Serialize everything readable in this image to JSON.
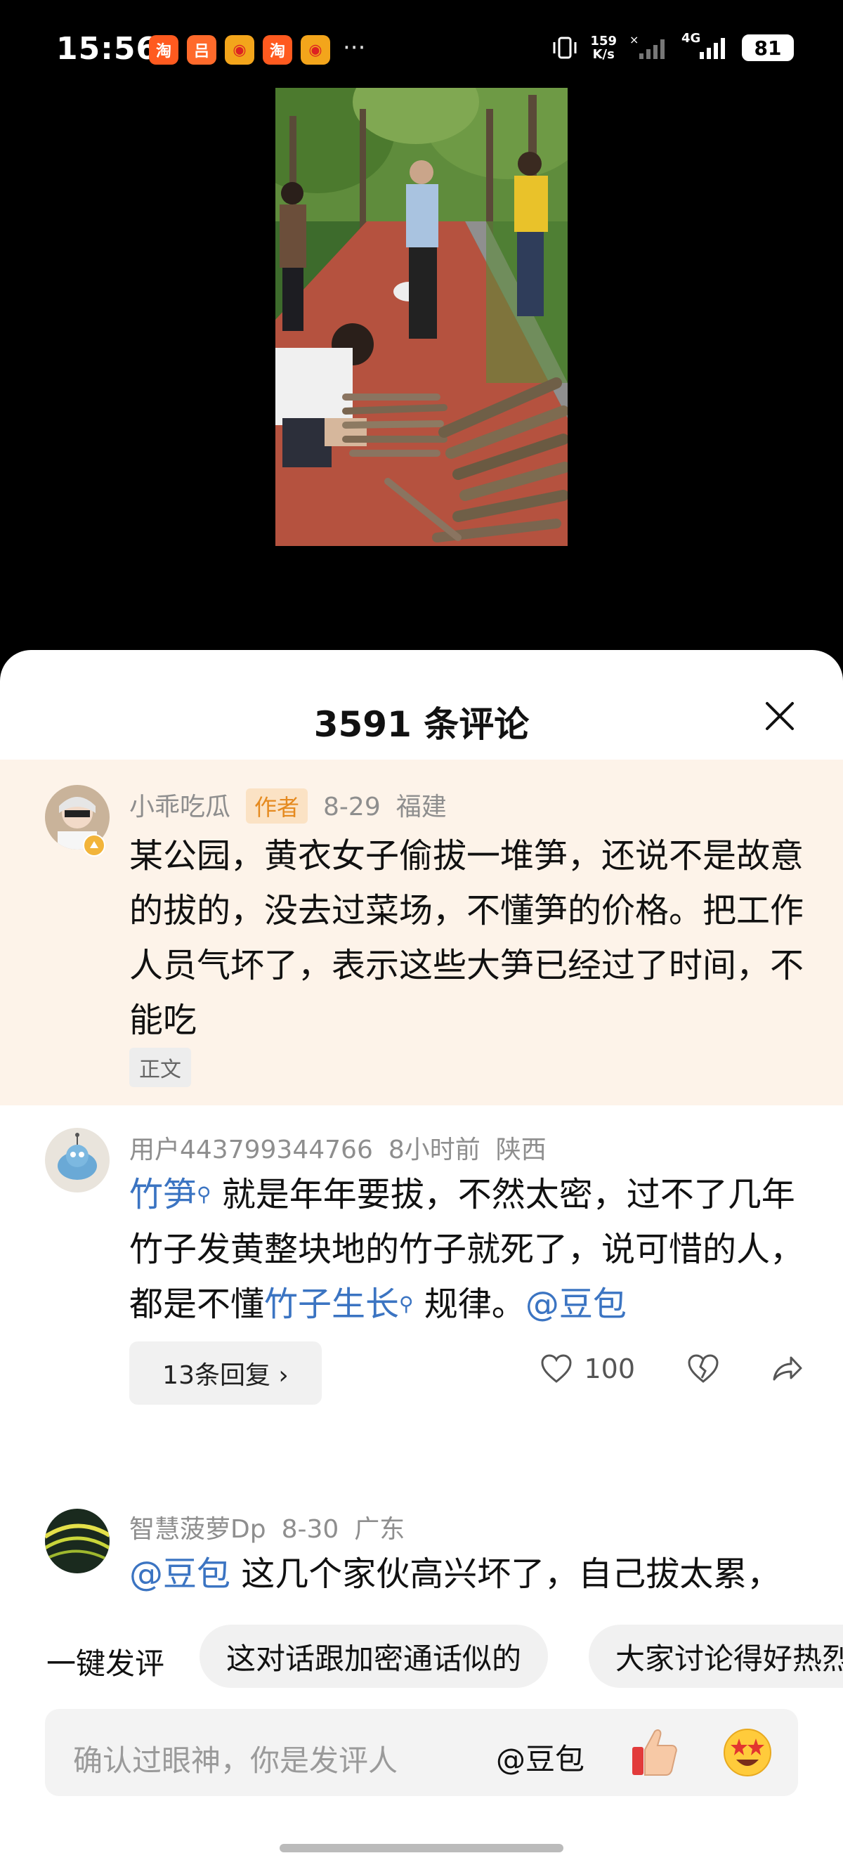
{
  "status_bar": {
    "time": "15:56",
    "app_icons": [
      {
        "name": "taobao-icon",
        "glyph": "淘",
        "color": "#ff5a1f"
      },
      {
        "name": "delivery-icon",
        "glyph": "吕",
        "color": "#ff6a2b"
      },
      {
        "name": "weibo-icon",
        "glyph": "◉",
        "color": "#f3a51b"
      },
      {
        "name": "taobao-icon",
        "glyph": "淘",
        "color": "#ff5a1f"
      },
      {
        "name": "weibo-icon",
        "glyph": "◉",
        "color": "#f3a51b"
      }
    ],
    "more": "···",
    "net_speed_value": "159",
    "net_speed_unit": "K/s",
    "network": "4G",
    "battery": "81"
  },
  "sheet": {
    "title": "3591 条评论"
  },
  "comments": [
    {
      "username": "小乖吃瓜",
      "author_tag": "作者",
      "date": "8-29",
      "location": "福建",
      "text": "某公园，黄衣女子偷拔一堆笋，还说不是故意的拔的，没去过菜场，不懂笋的价格。把工作人员气坏了，表示这些大笋已经过了时间，不能吃",
      "tag": "正文"
    },
    {
      "username": "用户443799344766",
      "date": "8小时前",
      "location": "陕西",
      "link1": "竹笋",
      "text1": " 就是年年要拔，不然太密，过不了几年竹子发黄整块地的竹子就死了，说可惜的人，都是不懂",
      "link2": "竹子生长",
      "text2": " 规律。",
      "mention": "@豆包",
      "replies": "13条回复 ›",
      "likes": "100"
    },
    {
      "username": "智慧菠萝Dp",
      "date": "8-30",
      "location": "广东",
      "mention": "@豆包",
      "text": " 这几个家伙高兴坏了，自己拔太累，"
    }
  ],
  "quick_comment": {
    "label": "一键发评",
    "chips": [
      "这对话跟加密通话似的",
      "大家讨论得好热烈"
    ]
  },
  "input": {
    "placeholder": "确认过眼神，你是发评人",
    "at_label": "@豆包"
  }
}
